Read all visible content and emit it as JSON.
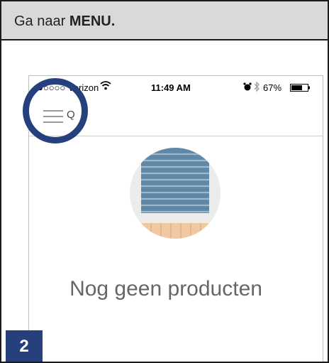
{
  "instruction": {
    "prefix": "Ga naar ",
    "emphasis": "MENU."
  },
  "status_bar": {
    "carrier": "●○○○○ Verizon",
    "time": "11:49 AM",
    "battery_pct": "67%",
    "icons": [
      "wifi-icon",
      "alarm-icon",
      "bluetooth-icon",
      "battery-icon"
    ]
  },
  "nav": {
    "search_label": "Q",
    "icons": [
      "hamburger-menu-icon",
      "search-icon"
    ]
  },
  "empty_state": {
    "title": "Nog geen producten",
    "illustration": "pleated-blind-icon"
  },
  "step": {
    "number": "2"
  },
  "colors": {
    "accent": "#26407e",
    "header_bg": "#d9d9d9",
    "blind_blue": "#5f87a6",
    "blind_light": "#9db7cb",
    "floor": "#f2c8a2"
  }
}
